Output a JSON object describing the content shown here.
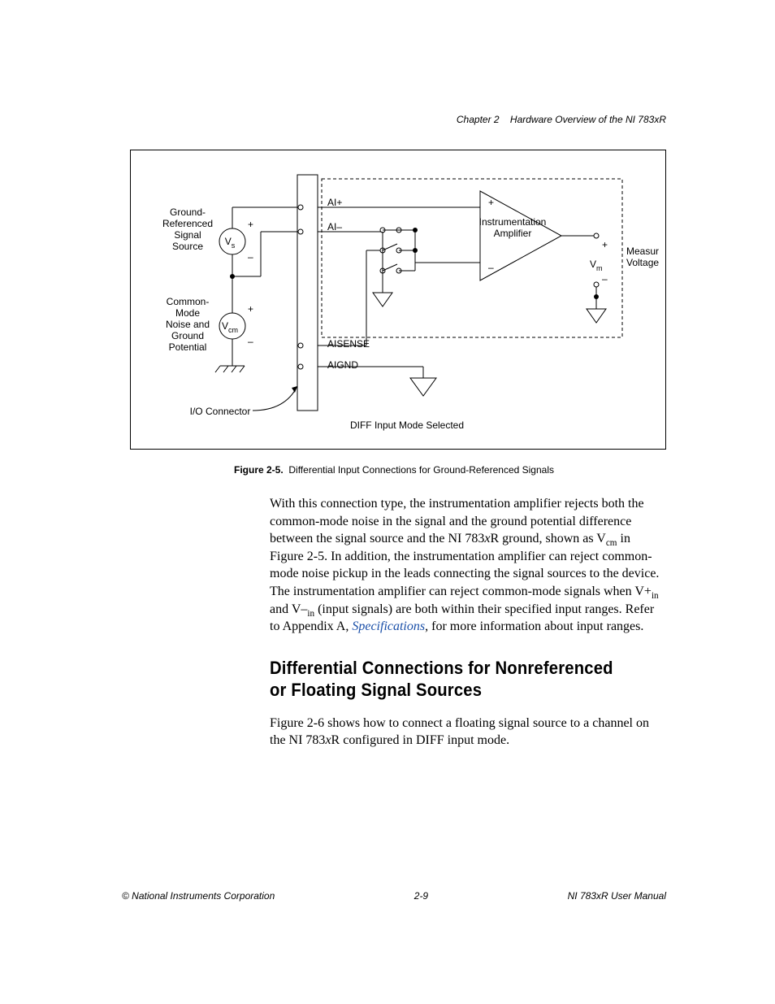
{
  "header": {
    "chapter": "Chapter 2",
    "title": "Hardware Overview of the NI 783xR"
  },
  "figure": {
    "id": "Figure 2-5.",
    "caption": "Differential Input Connections for Ground-Referenced Signals",
    "labels": {
      "source_line1": "Ground-",
      "source_line2": "Referenced",
      "source_line3": "Signal",
      "source_line4": "Source",
      "common_line1": "Common-",
      "common_line2": "Mode",
      "common_line3": "Noise and",
      "common_line4": "Ground",
      "common_line5": "Potential",
      "io_connector": "I/O Connector",
      "vs": "V",
      "vs_sub": "s",
      "vcm": "V",
      "vcm_sub": "cm",
      "ai_plus": "AI+",
      "ai_minus": "AI–",
      "aisense": "AISENSE",
      "aignd": "AIGND",
      "amp_line1": "Instrumentation",
      "amp_line2": "Amplifier",
      "vm": "V",
      "vm_sub": "m",
      "measured_line1": "Measured",
      "measured_line2": "Voltage",
      "mode": "DIFF Input Mode Selected"
    }
  },
  "paragraph1_html": "With this connection type, the instrumentation amplifier rejects both the common-mode noise in the signal and the ground potential difference between the signal source and the NI 783<i>x</i>R ground, shown as V<sub>cm</sub> in Figure 2-5. In addition, the instrumentation amplifier can reject common-mode noise pickup in the leads connecting the signal sources to the device. The instrumentation amplifier can reject common-mode signals when V+<sub>in</sub> and V–<sub>in</sub> (input signals) are both within their specified input ranges. Refer to Appendix A, <a href=\"#\" data-name=\"specifications-link\" data-interactable=\"true\">Specifications</a>, for more information about input ranges.",
  "section": {
    "heading": "Differential Connections for Nonreferenced or Floating Signal Sources"
  },
  "paragraph2_html": "Figure 2-6 shows how to connect a floating signal source to a channel on the NI 783<i>x</i>R configured in DIFF input mode.",
  "footer": {
    "left": "© National Instruments Corporation",
    "center": "2-9",
    "right": "NI 783xR User Manual"
  }
}
